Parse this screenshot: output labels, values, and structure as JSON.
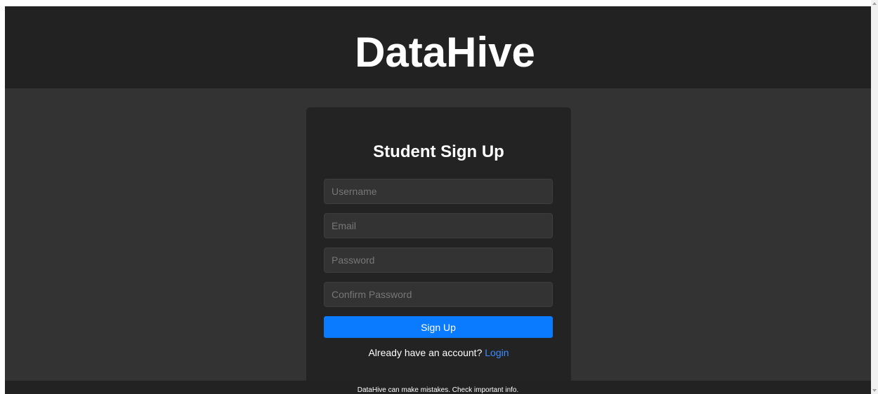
{
  "header": {
    "brand": "DataHive"
  },
  "signup_form": {
    "title": "Student Sign Up",
    "username": {
      "placeholder": "Username",
      "value": ""
    },
    "email": {
      "placeholder": "Email",
      "value": ""
    },
    "password": {
      "placeholder": "Password",
      "value": ""
    },
    "confirm_password": {
      "placeholder": "Confirm Password",
      "value": ""
    },
    "submit_label": "Sign Up",
    "login_prompt": "Already have an account?",
    "login_link": "Login"
  },
  "footer": {
    "disclaimer": "DataHive can make mistakes. Check important info."
  },
  "colors": {
    "header_bg": "#222222",
    "page_bg": "#333333",
    "card_bg": "#232323",
    "accent": "#0a7aff",
    "link": "#3d8bff"
  }
}
